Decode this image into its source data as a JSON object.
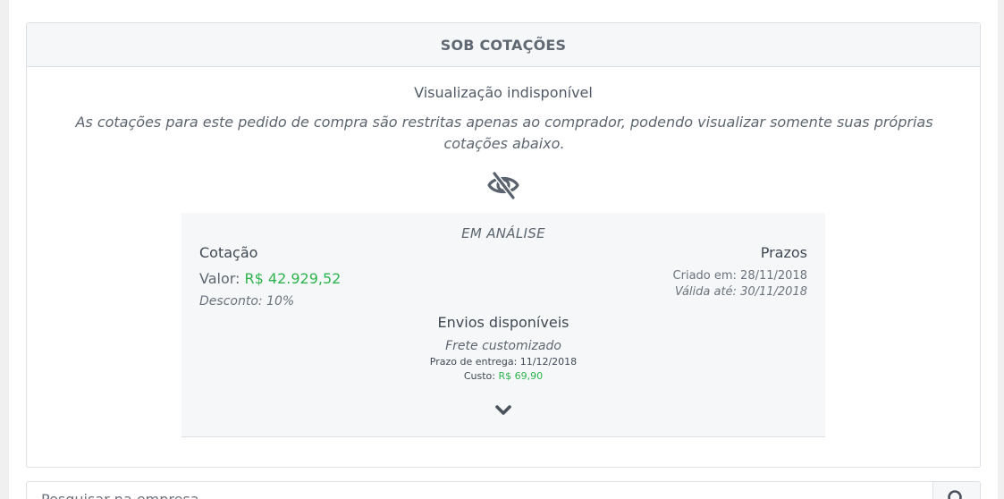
{
  "card": {
    "header": "SOB COTAÇÕES",
    "unavailable_title": "Visualização indisponível",
    "unavailable_description": "As cotações para este pedido de compra são restritas apenas ao comprador, podendo visualizar somente suas próprias cotações abaixo."
  },
  "quote": {
    "status": "EM ANÁLISE",
    "title": "Cotação",
    "valor_label": "Valor:",
    "valor_amount": "R$ 42.929,52",
    "discount": "Desconto: 10%",
    "deadlines_title": "Prazos",
    "created": "Criado em: 28/11/2018",
    "valid_until": "Válida até: 30/11/2018",
    "shipping_title": "Envios disponíveis",
    "shipping_method": "Frete customizado",
    "delivery_deadline": "Prazo de entrega: 11/12/2018",
    "cost_label": "Custo:",
    "cost_amount": "R$ 69,90"
  },
  "search": {
    "placeholder": "Pesquisar na empresa"
  },
  "colors": {
    "accent_green": "#2eb44f",
    "header_bg": "#f6f7f8"
  },
  "icons": {
    "visibility": "eye-slash-icon",
    "expand": "chevron-down-icon",
    "search": "search-icon"
  }
}
